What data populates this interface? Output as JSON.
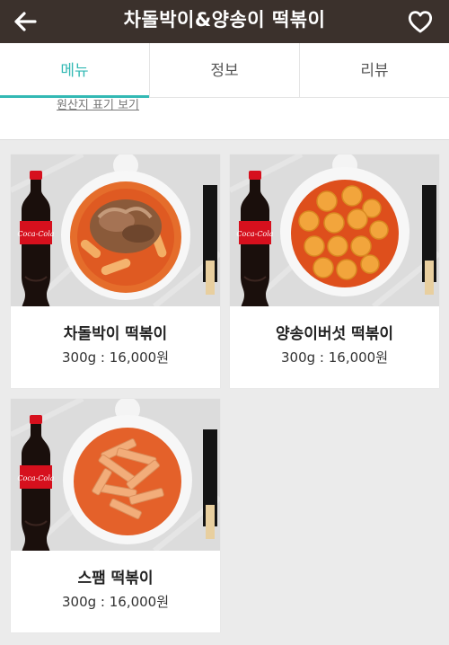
{
  "header": {
    "title": "차돌박이&양송이 떡볶이",
    "back_icon": "arrow-left-icon",
    "favorite_icon": "heart-outline-icon"
  },
  "tabs": [
    {
      "label": "메뉴",
      "active": true
    },
    {
      "label": "정보",
      "active": false
    },
    {
      "label": "리뷰",
      "active": false
    }
  ],
  "origin_link": "원산지 표기 보기",
  "menu_items": [
    {
      "name": "차돌박이 떡볶이",
      "price": "300g : 16,000원",
      "topping": "brisket"
    },
    {
      "name": "양송이버섯 떡볶이",
      "price": "300g : 16,000원",
      "topping": "mushroom"
    },
    {
      "name": "스팸 떡볶이",
      "price": "300g : 16,000원",
      "topping": "spam"
    }
  ],
  "colors": {
    "header_bg": "#3b312c",
    "accent": "#33b9b4",
    "page_bg": "#ebebeb"
  }
}
